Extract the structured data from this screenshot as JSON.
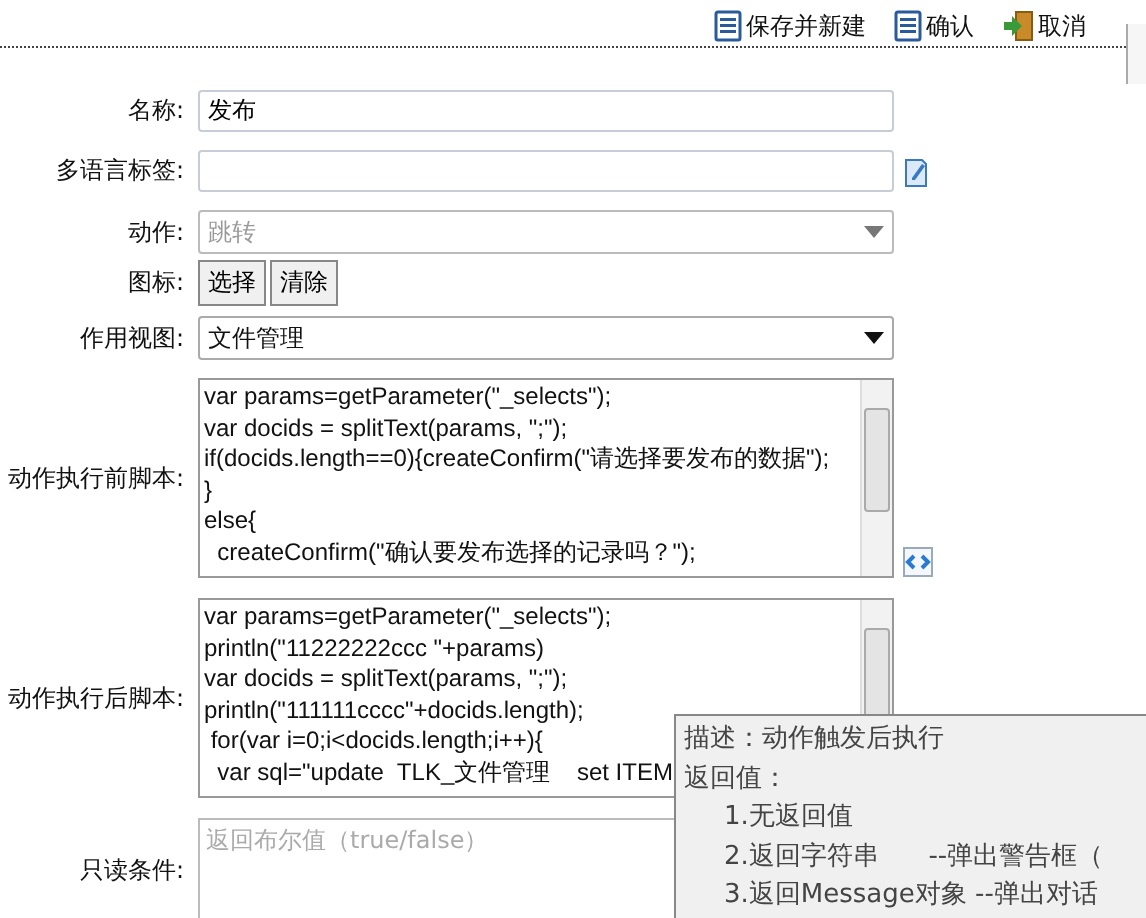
{
  "toolbar": [
    {
      "kind": "save",
      "label": "保存并新建"
    },
    {
      "kind": "save",
      "label": "确认"
    },
    {
      "kind": "exit",
      "label": "取消"
    }
  ],
  "form": {
    "name": {
      "label": "名称:",
      "value": "发布"
    },
    "multilang": {
      "label": "多语言标签:"
    },
    "action": {
      "label": "动作:",
      "value": "跳转",
      "disabled": true
    },
    "icon": {
      "label": "图标:",
      "buttons": [
        "选择",
        "清除"
      ]
    },
    "view": {
      "label": "作用视图:",
      "value": "文件管理"
    },
    "before_script": {
      "label": "动作执行前脚本:",
      "lines": [
        "var params=getParameter(\"_selects\");",
        "var docids = splitText(params, \";\");",
        "if(docids.length==0){createConfirm(\"请选择要发布的数据\");",
        "}",
        "else{",
        "  createConfirm(\"确认要发布选择的记录吗？\");"
      ]
    },
    "after_script": {
      "label": "动作执行后脚本:",
      "lines": [
        "var params=getParameter(\"_selects\");",
        "println(\"11222222ccc \"+params)",
        "var docids = splitText(params, \";\");",
        "println(\"111111cccc\"+docids.length);",
        " for(var i=0;i<docids.length;i++){",
        "  var sql=\"update  TLK_文件管理    set ITEM"
      ]
    },
    "readonly": {
      "label": "只读条件:",
      "placeholder": "返回布尔值（true/false）"
    }
  },
  "tooltip": {
    "lines": [
      "描述：动作触发后执行",
      "返回值：",
      "1.无返回值",
      "2.返回字符串      --弹出警告框（",
      "3.返回Message对象 --弹出对话"
    ]
  }
}
